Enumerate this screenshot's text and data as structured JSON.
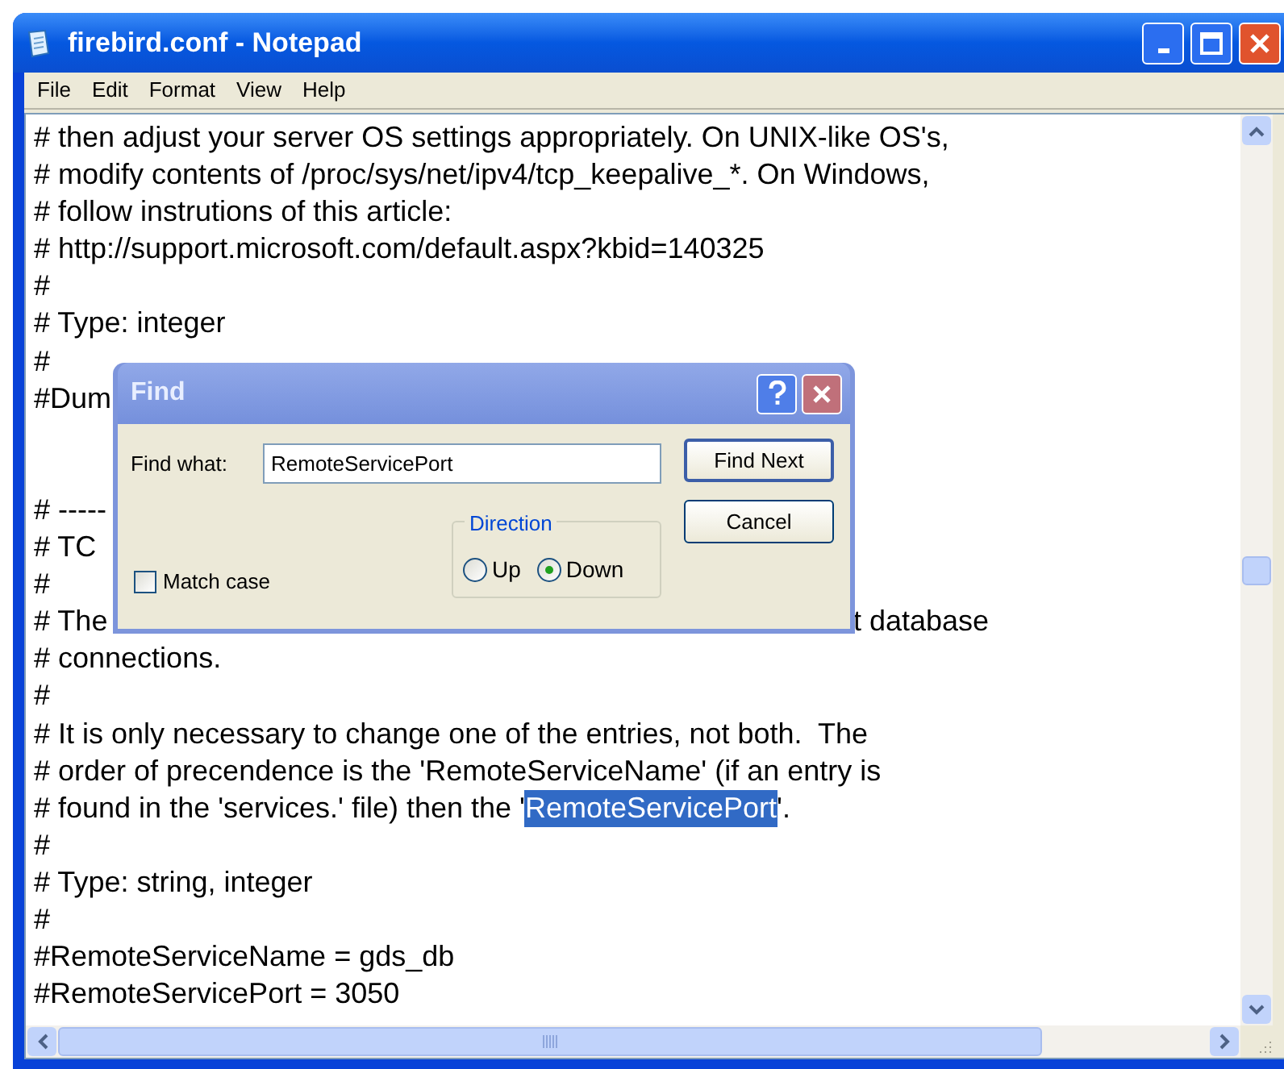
{
  "window": {
    "title": "firebird.conf - Notepad"
  },
  "menu": [
    {
      "label": "File"
    },
    {
      "label": "Edit"
    },
    {
      "label": "Format"
    },
    {
      "label": "View"
    },
    {
      "label": "Help"
    }
  ],
  "editor": {
    "lines": [
      {
        "kind": "text",
        "segments": [
          {
            "text": "# then adjust your server OS settings appropriately. On UNIX-like OS's,",
            "selected": false,
            "kind": "inline"
          }
        ]
      },
      {
        "kind": "text",
        "segments": [
          {
            "text": "# modify contents of /proc/sys/net/ipv4/tcp_keepalive_*. On Windows,",
            "selected": false,
            "kind": "inline"
          }
        ]
      },
      {
        "kind": "text",
        "segments": [
          {
            "text": "# follow instrutions of this article:",
            "selected": false,
            "kind": "inline"
          }
        ]
      },
      {
        "kind": "text",
        "segments": [
          {
            "text": "# http://support.microsoft.com/default.aspx?kbid=140325",
            "selected": false,
            "kind": "inline"
          }
        ]
      },
      {
        "kind": "text",
        "segments": [
          {
            "text": "#",
            "selected": false,
            "kind": "inline"
          }
        ]
      },
      {
        "kind": "text",
        "segments": [
          {
            "text": "# Type: integer",
            "selected": false,
            "kind": "inline"
          }
        ]
      },
      {
        "kind": "text",
        "segments": [
          {
            "text": "#",
            "selected": false,
            "kind": "inline"
          }
        ]
      },
      {
        "kind": "text",
        "segments": [
          {
            "text": "#Dum",
            "selected": false,
            "kind": "inline"
          }
        ]
      },
      {
        "kind": "blank"
      },
      {
        "kind": "blank"
      },
      {
        "kind": "text",
        "segments": [
          {
            "text": "# -----",
            "selected": false,
            "kind": "inline"
          }
        ]
      },
      {
        "kind": "text",
        "segments": [
          {
            "text": "# TC",
            "selected": false,
            "kind": "inline"
          }
        ]
      },
      {
        "kind": "text",
        "segments": [
          {
            "text": "#",
            "selected": false,
            "kind": "inline"
          }
        ]
      },
      {
        "kind": "text",
        "segments": [
          {
            "text": "# The",
            "selected": false,
            "kind": "inline"
          },
          {
            "text": "t database",
            "selected": false,
            "kind": "past-dialog"
          }
        ]
      },
      {
        "kind": "text",
        "segments": [
          {
            "text": "# connections.",
            "selected": false,
            "kind": "inline"
          }
        ]
      },
      {
        "kind": "text",
        "segments": [
          {
            "text": "#",
            "selected": false,
            "kind": "inline"
          }
        ]
      },
      {
        "kind": "text",
        "segments": [
          {
            "text": "# It is only necessary to change one of the entries, not both.  The",
            "selected": false,
            "kind": "inline"
          }
        ]
      },
      {
        "kind": "text",
        "segments": [
          {
            "text": "# order of precendence is the 'RemoteServiceName' (if an entry is",
            "selected": false,
            "kind": "inline"
          }
        ]
      },
      {
        "kind": "text",
        "segments": [
          {
            "text": "# found in the 'services.' file) then the '",
            "selected": false,
            "kind": "inline"
          },
          {
            "text": "RemoteServicePort",
            "selected": true,
            "kind": "inline"
          },
          {
            "text": "'.",
            "selected": false,
            "kind": "inline"
          }
        ]
      },
      {
        "kind": "text",
        "segments": [
          {
            "text": "#",
            "selected": false,
            "kind": "inline"
          }
        ]
      },
      {
        "kind": "text",
        "segments": [
          {
            "text": "# Type: string, integer",
            "selected": false,
            "kind": "inline"
          }
        ]
      },
      {
        "kind": "text",
        "segments": [
          {
            "text": "#",
            "selected": false,
            "kind": "inline"
          }
        ]
      },
      {
        "kind": "text",
        "segments": [
          {
            "text": "#RemoteServiceName = gds_db",
            "selected": false,
            "kind": "inline"
          }
        ]
      },
      {
        "kind": "text",
        "segments": [
          {
            "text": "#RemoteServicePort = 3050",
            "selected": false,
            "kind": "inline"
          }
        ]
      }
    ]
  },
  "find_dialog": {
    "title": "Find",
    "find_what_label": "Find what:",
    "find_what_value": "RemoteServicePort",
    "match_case": {
      "label": "Match case",
      "checked": false
    },
    "direction": {
      "label": "Direction",
      "options": [
        {
          "label": "Up",
          "selected": false
        },
        {
          "label": "Down",
          "selected": true
        }
      ]
    },
    "buttons": [
      {
        "label": "Find Next",
        "default": true
      },
      {
        "label": "Cancel",
        "default": false
      }
    ]
  }
}
